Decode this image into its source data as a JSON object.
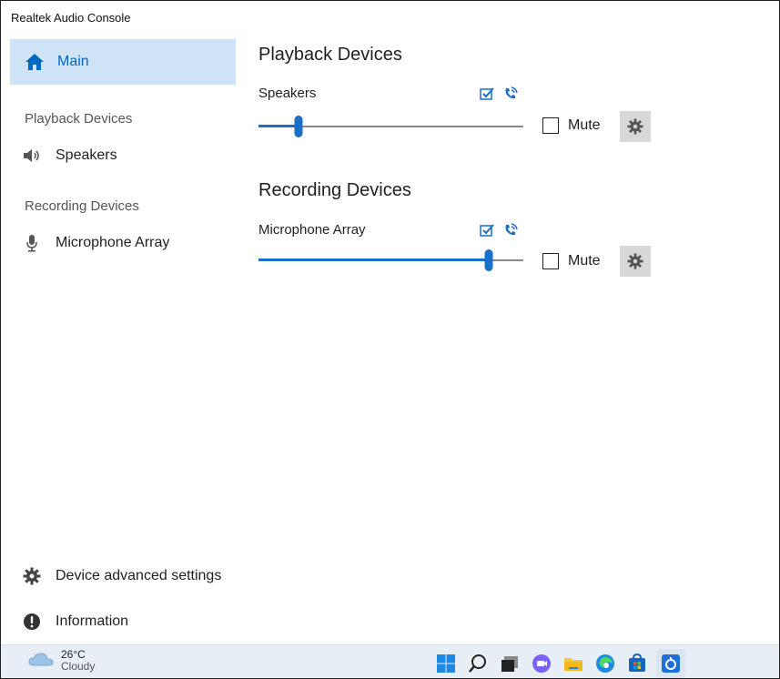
{
  "window": {
    "title": "Realtek Audio Console"
  },
  "sidebar": {
    "main_label": "Main",
    "playback_heading": "Playback Devices",
    "playback_items": [
      {
        "label": "Speakers",
        "icon": "speaker-icon"
      }
    ],
    "recording_heading": "Recording Devices",
    "recording_items": [
      {
        "label": "Microphone Array",
        "icon": "microphone-icon"
      }
    ],
    "bottom_items": [
      {
        "label": "Device advanced settings",
        "icon": "gear-icon"
      },
      {
        "label": "Information",
        "icon": "info-icon"
      }
    ]
  },
  "content": {
    "playback_title": "Playback Devices",
    "recording_title": "Recording Devices",
    "playback_device": {
      "name": "Speakers",
      "volume_fraction": 0.15,
      "mute_label": "Mute",
      "muted": false
    },
    "recording_device": {
      "name": "Microphone Array",
      "volume_fraction": 0.87,
      "mute_label": "Mute",
      "muted": false
    }
  },
  "taskbar": {
    "temperature": "26°C",
    "condition": "Cloudy",
    "icons": [
      "windows-start-icon",
      "search-icon",
      "task-view-icon",
      "chat-icon",
      "file-explorer-icon",
      "edge-icon",
      "store-icon",
      "realtek-icon"
    ]
  },
  "colors": {
    "accent": "#0067c0",
    "selected_bg": "#cfe3f6",
    "slider": "#1a6fc9",
    "button_bg": "#d8d8d8"
  }
}
